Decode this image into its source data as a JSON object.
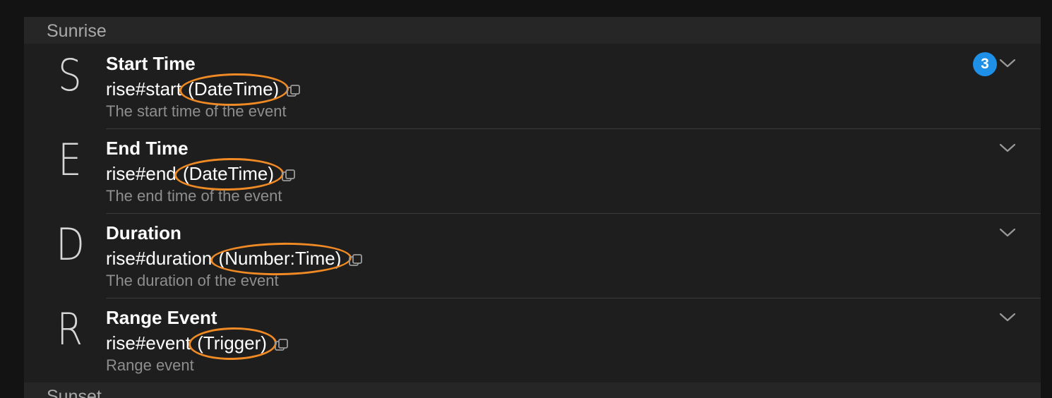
{
  "sections": [
    {
      "title": "Sunrise"
    },
    {
      "title": "Sunset"
    }
  ],
  "items": [
    {
      "letter": "S",
      "title": "Start Time",
      "id": "rise#start",
      "type": "(DateTime)",
      "description": "The start time of the event",
      "badge": "3"
    },
    {
      "letter": "E",
      "title": "End Time",
      "id": "rise#end",
      "type": "(DateTime)",
      "description": "The end time of the event"
    },
    {
      "letter": "D",
      "title": "Duration",
      "id": "rise#duration",
      "type": "(Number:Time)",
      "description": "The duration of the event"
    },
    {
      "letter": "R",
      "title": "Range Event",
      "id": "rise#event",
      "type": "(Trigger)",
      "description": "Range event"
    }
  ],
  "icons": {
    "copy": "copy-icon",
    "expand": "chevron-down-icon"
  },
  "colors": {
    "badge": "#1e90e8",
    "annotation": "#f08a24"
  }
}
